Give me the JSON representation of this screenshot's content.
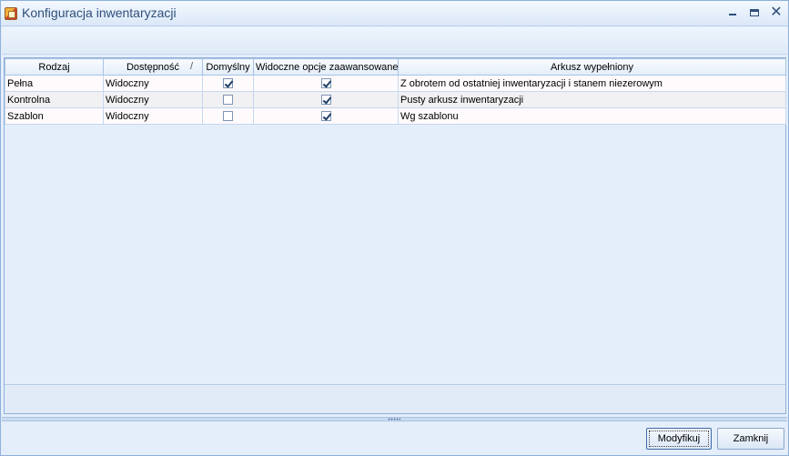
{
  "window": {
    "title": "Konfiguracja inwentaryzacji",
    "minimize": "",
    "maximize": "",
    "close": "✕"
  },
  "grid": {
    "columns": [
      {
        "label": "Rodzaj",
        "sort": ""
      },
      {
        "label": "Dostępność",
        "sort": "/"
      },
      {
        "label": "Domyślny",
        "sort": ""
      },
      {
        "label": "Widoczne opcje zaawansowane",
        "sort": ""
      },
      {
        "label": "Arkusz wypełniony",
        "sort": ""
      }
    ],
    "rows": [
      {
        "rodzaj": "Pełna",
        "dostepnosc": "Widoczny",
        "domyslny": true,
        "widoczne_opcje": true,
        "arkusz": "Z obrotem od ostatniej inwentaryzacji i stanem niezerowym"
      },
      {
        "rodzaj": "Kontrolna",
        "dostepnosc": "Widoczny",
        "domyslny": false,
        "widoczne_opcje": true,
        "arkusz": "Pusty arkusz inwentaryzacji"
      },
      {
        "rodzaj": "Szablon",
        "dostepnosc": "Widoczny",
        "domyslny": false,
        "widoczne_opcje": true,
        "arkusz": "Wg szablonu"
      }
    ]
  },
  "buttons": {
    "modify": "Modyfikuj",
    "close": "Zamknij"
  },
  "icons": {
    "app": "app-logo-icon",
    "sort": "sort-indicator-icon",
    "checkbox": "checkbox-icon"
  }
}
